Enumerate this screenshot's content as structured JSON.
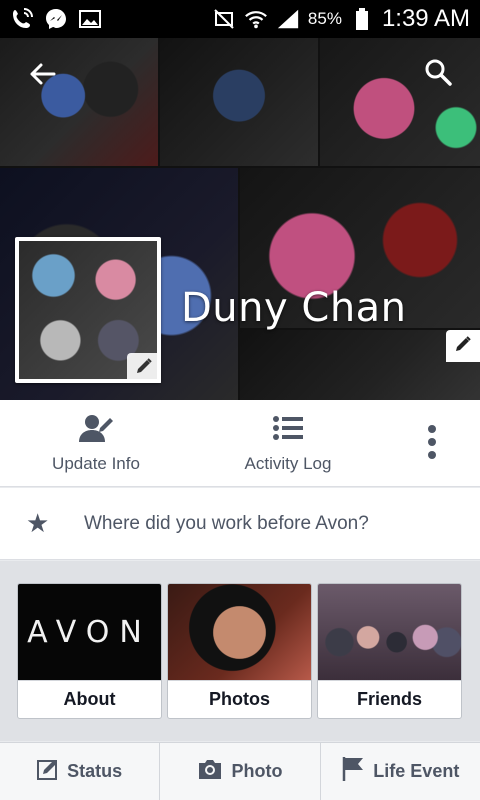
{
  "status_bar": {
    "battery": "85%",
    "time": "1:39 AM",
    "icons": [
      "phone-wifi-icon",
      "messenger-icon",
      "image-icon",
      "nfc-mute-icon",
      "wifi-icon",
      "signal-icon",
      "battery-icon"
    ]
  },
  "header": {
    "icons": [
      "back-arrow-icon",
      "search-icon"
    ]
  },
  "profile": {
    "name": "Duny Chan"
  },
  "actions": {
    "update_info": "Update Info",
    "activity_log": "Activity Log"
  },
  "prompt": {
    "text": "Where did you work before Avon?"
  },
  "cards": {
    "about": {
      "label": "About",
      "image_text": "AVON"
    },
    "photos": {
      "label": "Photos"
    },
    "friends": {
      "label": "Friends"
    }
  },
  "bottom_bar": {
    "status": "Status",
    "photo": "Photo",
    "life_event": "Life Event"
  },
  "colors": {
    "text": "#4e5665",
    "background": "#e9ebee"
  }
}
